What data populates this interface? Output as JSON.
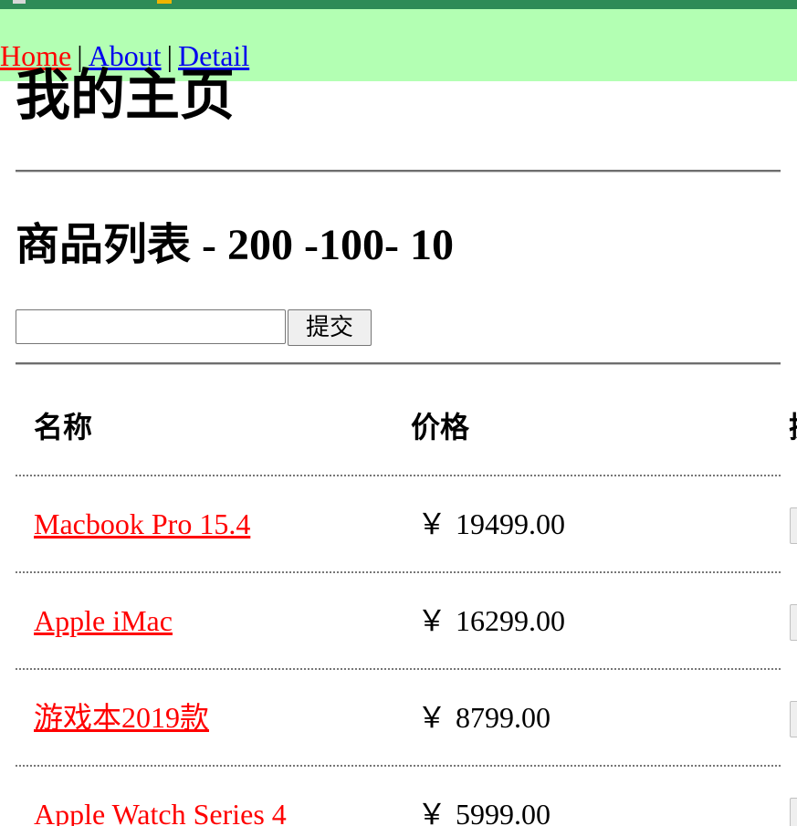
{
  "nav": {
    "home": "Home",
    "about": "About",
    "detail": "Detail",
    "separator": "|"
  },
  "page_title": "我的主页",
  "section": {
    "title_cn": "商品列表",
    "title_rest": " - 200 -100- 10"
  },
  "search": {
    "value": "",
    "placeholder": "",
    "submit_label": "提交"
  },
  "table": {
    "headers": [
      "名称",
      "价格",
      "操"
    ],
    "rows": [
      {
        "name": "Macbook Pro 15.4",
        "currency": "￥",
        "price": "19499.00"
      },
      {
        "name": "Apple iMac",
        "currency": "￥",
        "price": "16299.00"
      },
      {
        "name": "游戏本2019款",
        "currency": "￥",
        "price": "8799.00"
      },
      {
        "name": "Apple Watch Series 4",
        "currency": "￥",
        "price": "5999.00"
      }
    ]
  },
  "colors": {
    "navbar_bg": "#b3ffb3",
    "top_strip": "#2e8b57",
    "active_link": "#ff0000",
    "link": "#0000ee",
    "product_link": "#ff0000"
  }
}
